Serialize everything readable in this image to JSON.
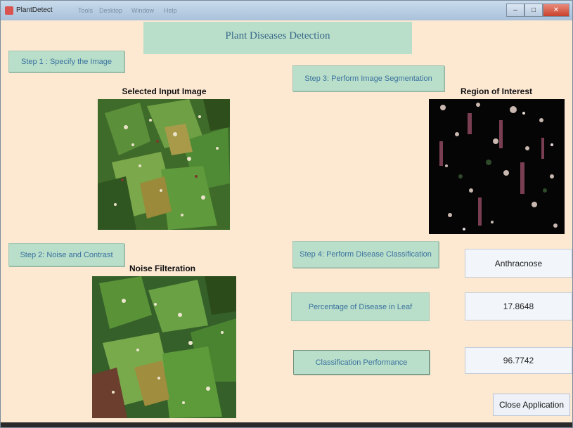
{
  "window": {
    "title": "PlantDetect",
    "menu_ghost": [
      "Tools",
      "Desktop",
      "Window",
      "Help"
    ],
    "controls": [
      "–",
      "□",
      "✕"
    ]
  },
  "app": {
    "title": "Plant Diseases Detection"
  },
  "steps": {
    "step1": "Step 1 : Specify the Image",
    "step2": "Step 2: Noise and Contrast",
    "step3": "Step 3: Perform Image Segmentation",
    "step4": "Step 4: Perform Disease Classification"
  },
  "labels": {
    "selected_input": "Selected Input Image",
    "noise_filteration": "Noise Filteration",
    "region_of_interest": "Region of Interest",
    "percentage": "Percentage of Disease in Leaf"
  },
  "buttons": {
    "classification_performance": "Classification Performance",
    "close_application": "Close Application"
  },
  "results": {
    "disease": "Anthracnose",
    "percentage": "17.8648",
    "performance": "96.7742"
  },
  "colors": {
    "background": "#fde8d2",
    "panel": "#b9dec9",
    "button_text": "#3a72a0"
  }
}
